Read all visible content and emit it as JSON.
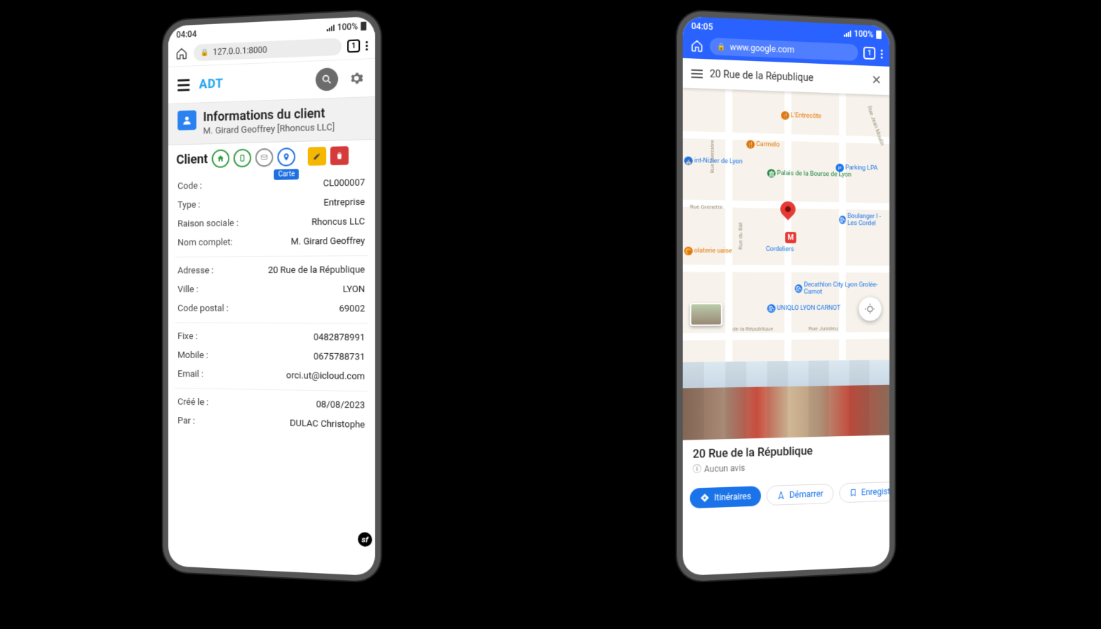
{
  "left": {
    "status": {
      "time": "04:04",
      "battery": "100%"
    },
    "browser": {
      "url": "127.0.0.1:8000",
      "tabs": "1"
    },
    "app": {
      "logo_text": "ADT"
    },
    "page": {
      "title": "Informations du client",
      "subtitle": "M. Girard Geoffrey [Rhoncus LLC]"
    },
    "client_bar": {
      "label": "Client",
      "pin_tooltip": "Carte"
    },
    "fields": {
      "code_k": "Code :",
      "code_v": "CL000007",
      "type_k": "Type :",
      "type_v": "Entreprise",
      "raison_k": "Raison sociale :",
      "raison_v": "Rhoncus LLC",
      "nom_k": "Nom complet:",
      "nom_v": "M. Girard Geoffrey",
      "adresse_k": "Adresse :",
      "adresse_v": "20 Rue de la République",
      "ville_k": "Ville :",
      "ville_v": "LYON",
      "cp_k": "Code postal :",
      "cp_v": "69002",
      "fixe_k": "Fixe :",
      "fixe_v": "0482878991",
      "mobile_k": "Mobile :",
      "mobile_v": "0675788731",
      "email_k": "Email :",
      "email_v": "orci.ut@icloud.com",
      "cree_k": "Créé le :",
      "cree_v": "08/08/2023",
      "par_k": "Par :",
      "par_v": "DULAC Christophe"
    }
  },
  "right": {
    "status": {
      "time": "04:05",
      "battery": "100%"
    },
    "browser": {
      "url": "www.google.com",
      "tabs": "1"
    },
    "search": {
      "query": "20 Rue de la République"
    },
    "map": {
      "pois": {
        "entrecote": "L'Entrecôte",
        "carmela": "Carmelo",
        "stnizier": "int-Nizier de Lyon",
        "palais": "Palais de la Bourse de Lyon",
        "parking": "Parking LPA",
        "boulang": "Boulanger I - Les Cordel",
        "cordeliers": "Cordeliers",
        "decathlon": "Decathlon City Lyon Grolée-Carnot",
        "uniqlo": "UNIQLO LYON CARNOT",
        "olaterie": "olaterie uaise"
      },
      "roads": {
        "merciere": "Rue Mercière",
        "grenette": "Rue Grenette",
        "republique": "de la République",
        "jussieu": "Rue Jussieu",
        "moulin": "Rue Jean Moulin",
        "bat": "Rue du Bât"
      },
      "metro_label": "M"
    },
    "place": {
      "name": "20 Rue de la République",
      "reviews": "Aucun avis"
    },
    "actions": {
      "directions": "Itinéraires",
      "start": "Démarrer",
      "save": "Enregist"
    }
  }
}
